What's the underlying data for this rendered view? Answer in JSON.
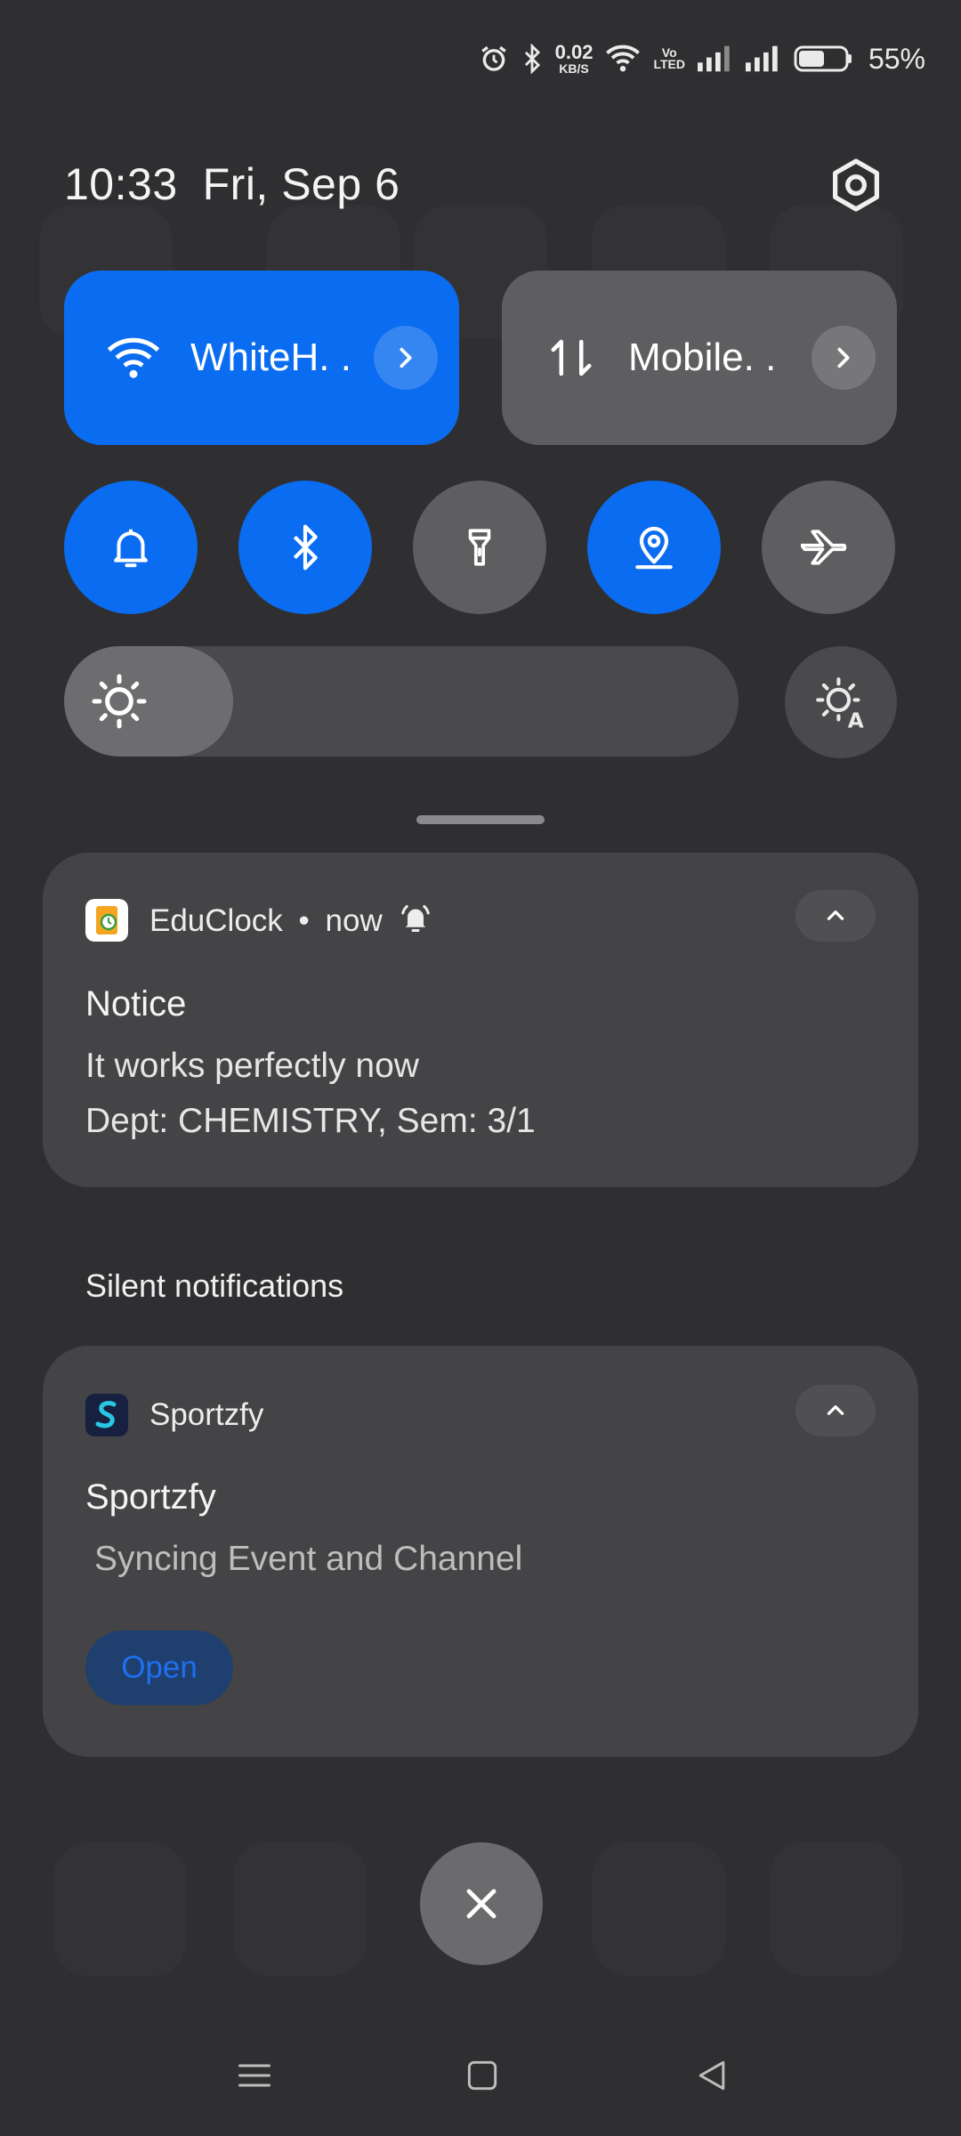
{
  "status_bar": {
    "net_speed_value": "0.02",
    "net_speed_unit": "KB/S",
    "volte_top": "Vo",
    "volte_bottom": "LTED",
    "battery_percent": "55%",
    "battery_level": 0.55,
    "icons": [
      "alarm-icon",
      "bluetooth-icon",
      "wifi-icon",
      "signal-icon",
      "signal-icon",
      "battery-icon"
    ]
  },
  "header": {
    "time": "10:33",
    "date": "Fri, Sep 6",
    "settings_icon": "settings-gear-icon"
  },
  "quick_tiles": {
    "wifi": {
      "label": "WhiteH. .",
      "active": true
    },
    "mobile": {
      "label": "Mobile. .",
      "active": false
    }
  },
  "toggles": [
    {
      "name": "sound",
      "icon": "bell-icon",
      "active": true
    },
    {
      "name": "bluetooth",
      "icon": "bluetooth-icon",
      "active": true
    },
    {
      "name": "flashlight",
      "icon": "flashlight-icon",
      "active": false
    },
    {
      "name": "location",
      "icon": "location-icon",
      "active": true
    },
    {
      "name": "airplane",
      "icon": "airplane-icon",
      "active": false
    }
  ],
  "brightness": {
    "level": 0.25
  },
  "notifications": [
    {
      "app": "EduClock",
      "time": "now",
      "title": "Notice",
      "line1": "It works perfectly now",
      "line2": "Dept: CHEMISTRY, Sem:  3/1"
    }
  ],
  "silent_section": {
    "heading": "Silent notifications",
    "items": [
      {
        "app": "Sportzfy",
        "title": "Sportzfy",
        "text": "Syncing Event and Channel",
        "action": "Open"
      }
    ]
  },
  "colors": {
    "accent": "#0a6cf0",
    "background": "#2f2f31",
    "card": "#444446",
    "tile_off": "#5e5e60"
  }
}
